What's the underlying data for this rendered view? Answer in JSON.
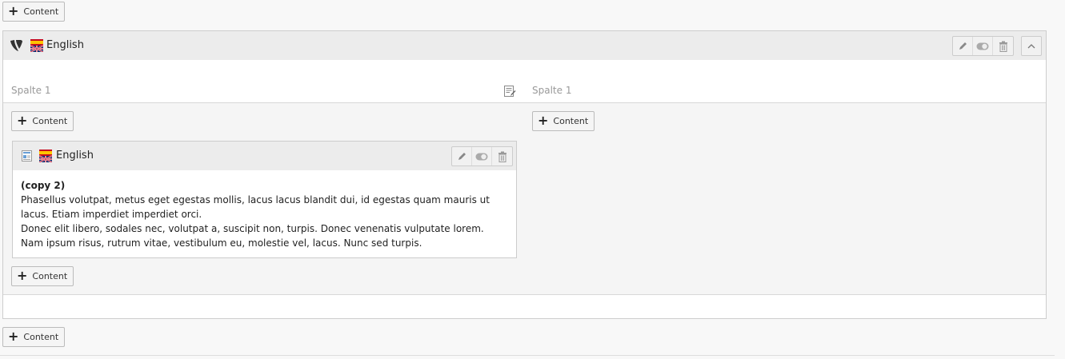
{
  "buttons": {
    "add_content": "Content"
  },
  "container": {
    "language": "English",
    "columns": [
      {
        "header": "Spalte 1"
      },
      {
        "header": "Spalte 1"
      }
    ]
  },
  "content_element": {
    "language": "English",
    "title": "(copy 2)",
    "body_line1": "Phasellus volutpat, metus eget egestas mollis, lacus lacus blandit dui, id egestas quam mauris ut",
    "body_line2": "lacus. Etiam imperdiet imperdiet orci.",
    "body_line3": "Donec elit libero, sodales nec, volutpat a, suscipit non, turpis. Donec venenatis vulputate lorem.",
    "body_line4": "Nam ipsum risus, rutrum vitae, vestibulum eu, molestie vel, lacus. Nunc sed turpis."
  },
  "icons": [
    "plus-icon",
    "typo3-icon",
    "flag-icon",
    "edit-icon",
    "toggle-icon",
    "delete-icon",
    "collapse-icon",
    "content-type-icon",
    "page-edit-icon"
  ],
  "colors": {
    "header_bg": "#ececec",
    "column_bg": "#f5f5f5",
    "border": "#cdcdcd"
  }
}
